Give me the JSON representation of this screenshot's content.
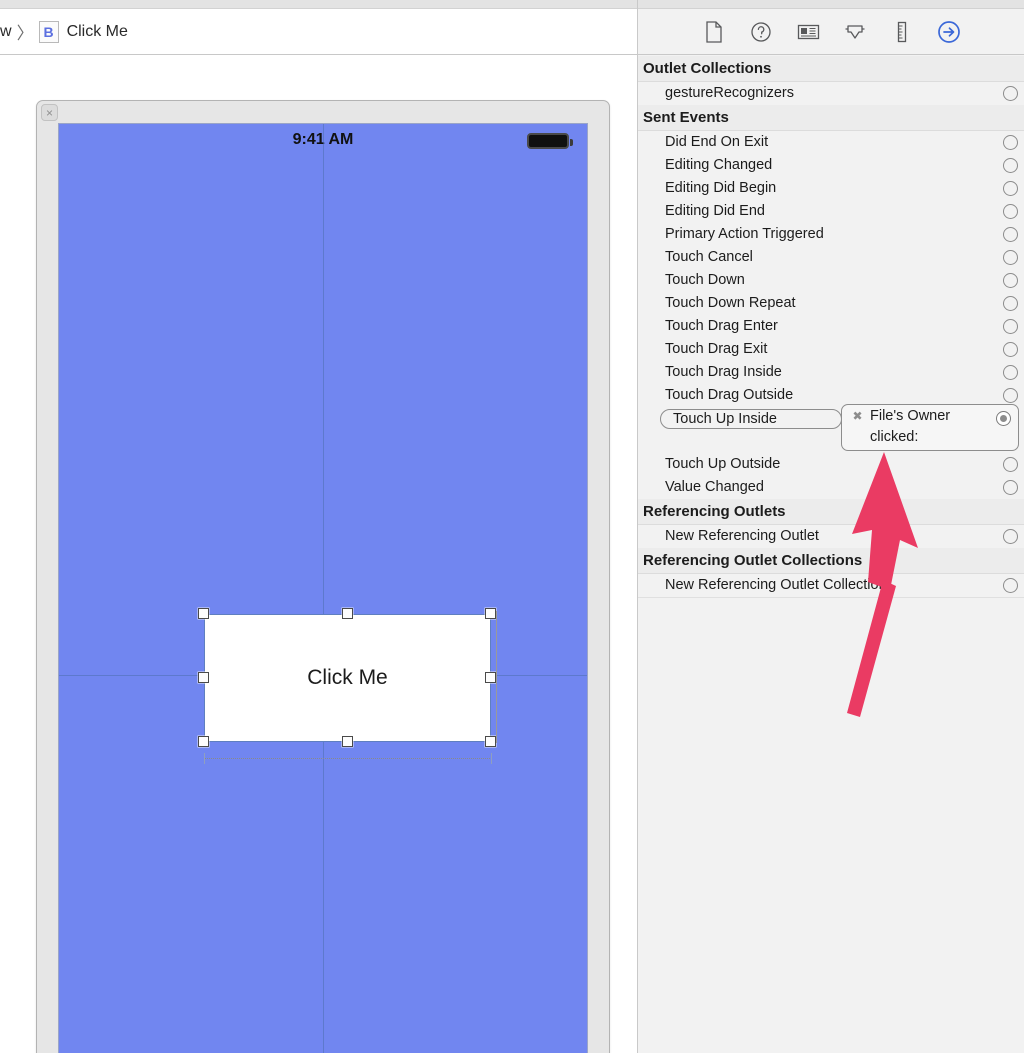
{
  "breadcrumb": {
    "truncated_crumb": "w",
    "separator": "〉",
    "badge": "B",
    "current": "Click Me"
  },
  "canvas": {
    "close_button": "×",
    "status_time": "9:41 AM",
    "button_label": "Click Me",
    "view_color": "#7186f0"
  },
  "inspector": {
    "tabs": [
      {
        "name": "file-inspector",
        "glyph": "🗋",
        "selected": false
      },
      {
        "name": "quick-help-inspector",
        "glyph": "?",
        "selected": false
      },
      {
        "name": "identity-inspector",
        "glyph": "▤",
        "selected": false
      },
      {
        "name": "attributes-inspector",
        "glyph": "⬇",
        "selected": false
      },
      {
        "name": "size-inspector",
        "glyph": "⫼",
        "selected": false
      },
      {
        "name": "connections-inspector",
        "glyph": "→",
        "selected": true
      }
    ],
    "sections": [
      {
        "title": "Outlet Collections",
        "rows": [
          {
            "label": "gestureRecognizers",
            "connected": false
          }
        ]
      },
      {
        "title": "Sent Events",
        "rows": [
          {
            "label": "Did End On Exit",
            "connected": false
          },
          {
            "label": "Editing Changed",
            "connected": false
          },
          {
            "label": "Editing Did Begin",
            "connected": false
          },
          {
            "label": "Editing Did End",
            "connected": false
          },
          {
            "label": "Primary Action Triggered",
            "connected": false
          },
          {
            "label": "Touch Cancel",
            "connected": false
          },
          {
            "label": "Touch Down",
            "connected": false
          },
          {
            "label": "Touch Down Repeat",
            "connected": false
          },
          {
            "label": "Touch Drag Enter",
            "connected": false
          },
          {
            "label": "Touch Drag Exit",
            "connected": false
          },
          {
            "label": "Touch Drag Inside",
            "connected": false
          },
          {
            "label": "Touch Drag Outside",
            "connected": false
          },
          {
            "label": "Touch Up Inside",
            "connected": true
          },
          {
            "label": "Touch Up Outside",
            "connected": false
          },
          {
            "label": "Value Changed",
            "connected": false
          }
        ]
      },
      {
        "title": "Referencing Outlets",
        "rows": [
          {
            "label": "New Referencing Outlet",
            "connected": false
          }
        ]
      },
      {
        "title": "Referencing Outlet Collections",
        "rows": [
          {
            "label": "New Referencing Outlet Collection",
            "connected": false
          }
        ]
      }
    ],
    "connection": {
      "event": "Touch Up Inside",
      "target": "File's Owner",
      "action": "clicked:",
      "delete_badge": "✖"
    }
  },
  "annotation": {
    "arrow_color": "#ea3b63"
  }
}
